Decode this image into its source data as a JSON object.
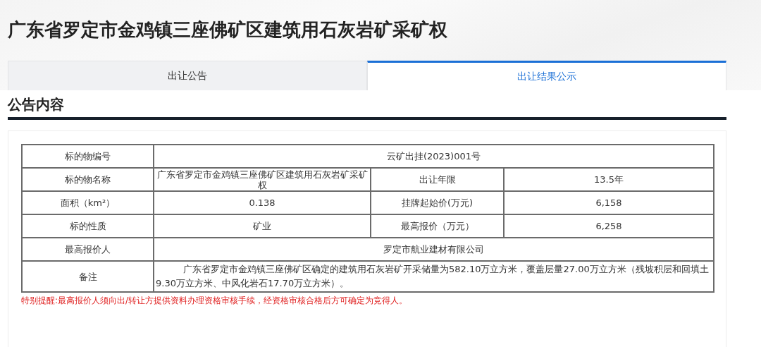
{
  "title": "广东省罗定市金鸡镇三座佛矿区建筑用石灰岩矿采矿权",
  "tabs": [
    {
      "label": "出让公告",
      "selected": false
    },
    {
      "label": "出让结果公示",
      "selected": true
    }
  ],
  "section_title": "公告内容",
  "table": {
    "rows": [
      {
        "cells": [
          {
            "text": "标的物编号"
          },
          {
            "text": "云矿出挂(2023)001号",
            "colspan": 3
          }
        ]
      },
      {
        "cells": [
          {
            "text": "标的物名称"
          },
          {
            "text": "广东省罗定市金鸡镇三座佛矿区建筑用石灰岩矿采矿权"
          },
          {
            "text": "出让年限"
          },
          {
            "text": "13.5年"
          }
        ]
      },
      {
        "cells": [
          {
            "text": "面积（km²）"
          },
          {
            "text": "0.138"
          },
          {
            "text": "挂牌起始价(万元)"
          },
          {
            "text": "6,158"
          }
        ]
      },
      {
        "cells": [
          {
            "text": "标的性质"
          },
          {
            "text": "矿业"
          },
          {
            "text": "最高报价（万元）"
          },
          {
            "text": "6,258"
          }
        ]
      },
      {
        "cells": [
          {
            "text": "最高报价人"
          },
          {
            "text": "罗定市航业建材有限公司",
            "colspan": 3
          }
        ]
      },
      {
        "cells": [
          {
            "text": "备注"
          },
          {
            "text": "广东省罗定市金鸡镇三座佛矿区确定的建筑用石灰岩矿开采储量为582.10万立方米，覆盖层量27.00万立方米（残坡积层和回填土9.30万立方米、中风化岩石17.70万立方米）。",
            "colspan": 3
          }
        ],
        "kind": "note"
      }
    ]
  },
  "notice": "特别提醒:最高报价人须向出/转让方提供资料办理资格审核手续，经资格审核合格后方可确定为竞得人。"
}
